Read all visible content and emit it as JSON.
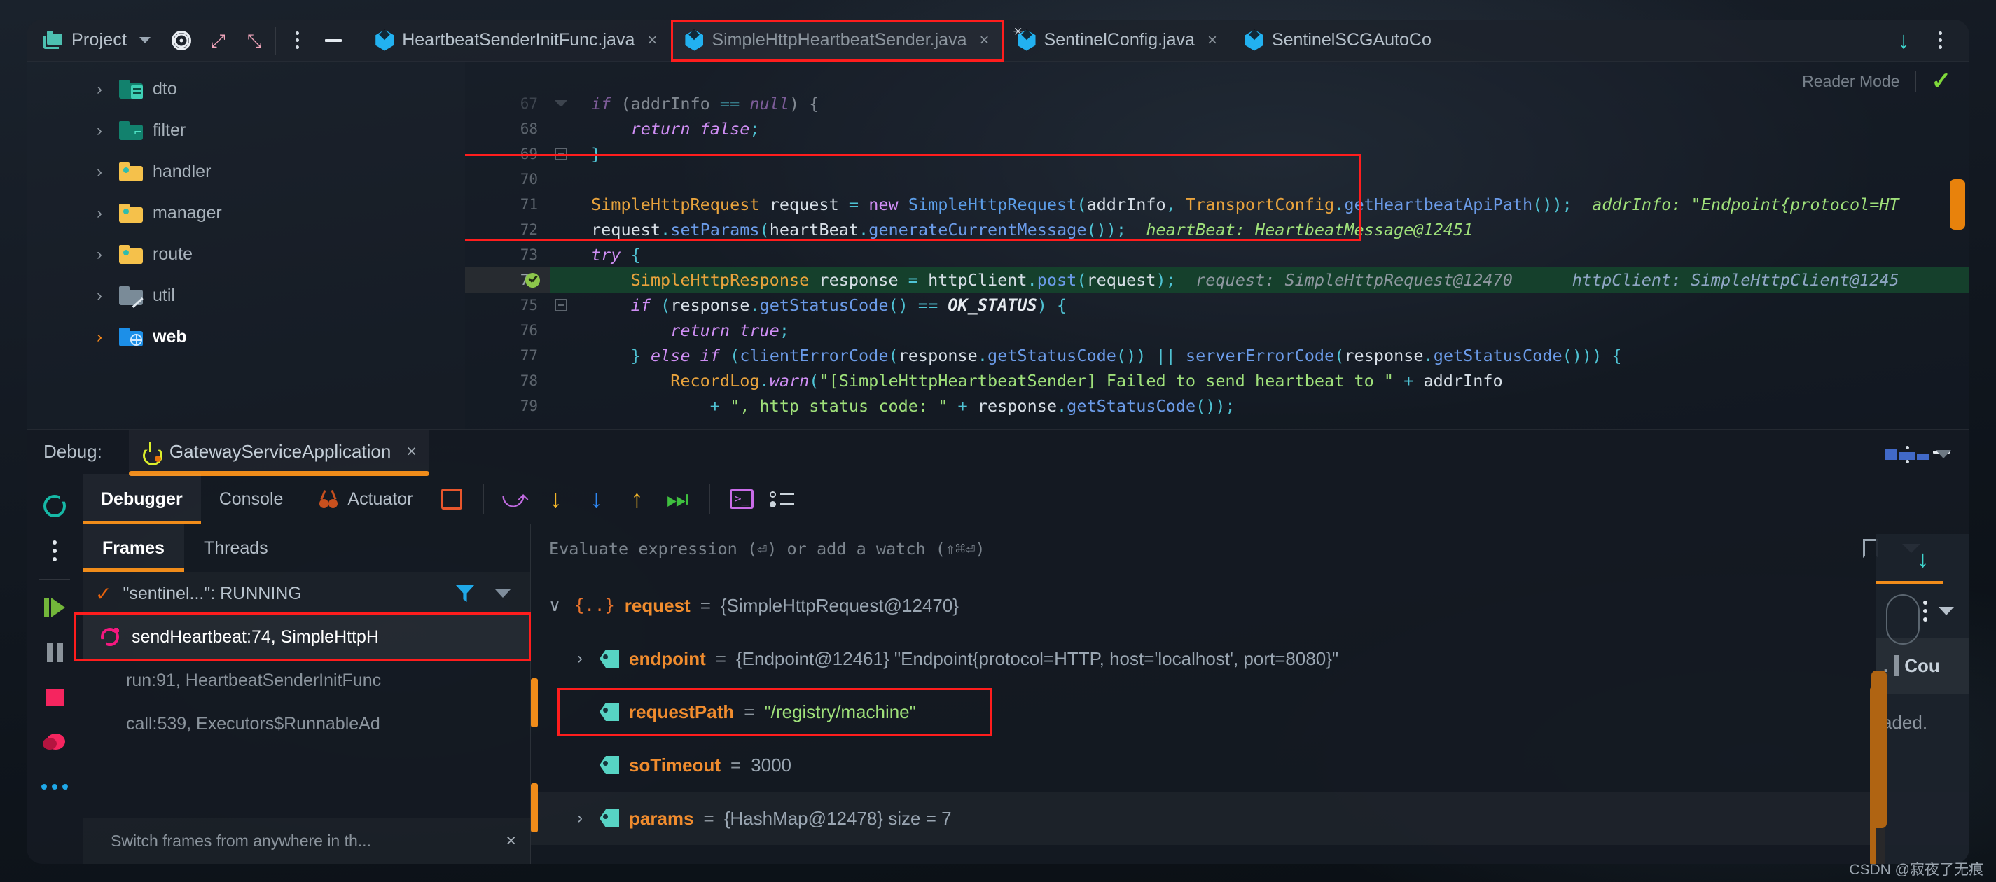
{
  "app": {
    "project_button": "Project",
    "reader_mode": "Reader Mode"
  },
  "editor_tabs": [
    {
      "label": "HeartbeatSenderInitFunc.java",
      "icon": "java-class-icon",
      "active": false,
      "close": "×"
    },
    {
      "label": "SimpleHttpHeartbeatSender.java",
      "icon": "java-class-icon",
      "active": true,
      "close": "×"
    },
    {
      "label": "SentinelConfig.java",
      "icon": "java-class-snowflake-icon",
      "active": false,
      "close": "×"
    },
    {
      "label": "SentinelSCGAutoCo",
      "icon": "java-class-icon",
      "active": false,
      "close": ""
    }
  ],
  "project_tree": [
    {
      "label": "dto",
      "icon": "folder-green-dto",
      "arrow": "›",
      "expanded": false
    },
    {
      "label": "filter",
      "icon": "folder-green-filter",
      "arrow": "›",
      "expanded": false
    },
    {
      "label": "handler",
      "icon": "folder-yellow",
      "arrow": "›",
      "expanded": false
    },
    {
      "label": "manager",
      "icon": "folder-yellow",
      "arrow": "›",
      "expanded": false
    },
    {
      "label": "route",
      "icon": "folder-yellow",
      "arrow": "›",
      "expanded": false
    },
    {
      "label": "util",
      "icon": "folder-grey-excluded",
      "arrow": "›",
      "expanded": false
    },
    {
      "label": "web",
      "icon": "folder-blue-web",
      "arrow": "›",
      "expanded": true
    }
  ],
  "code": {
    "lines": [
      {
        "num": "67",
        "fold": "tri"
      },
      {
        "num": "68",
        "fold": ""
      },
      {
        "num": "69",
        "fold": "box"
      },
      {
        "num": "70",
        "fold": ""
      },
      {
        "num": "71",
        "fold": ""
      },
      {
        "num": "72",
        "fold": ""
      },
      {
        "num": "73",
        "fold": ""
      },
      {
        "num": "74",
        "fold": "",
        "executing": true
      },
      {
        "num": "75",
        "fold": "box"
      },
      {
        "num": "76",
        "fold": ""
      },
      {
        "num": "77",
        "fold": ""
      },
      {
        "num": "78",
        "fold": ""
      },
      {
        "num": "79",
        "fold": ""
      }
    ],
    "inlay_hints": {
      "addr_info": "addrInfo: \"Endpoint{protocol=HT",
      "heart_beat": "heartBeat: HeartbeatMessage@12451",
      "request": "request: SimpleHttpRequest@12470",
      "http_client": "httpClient: SimpleHttpClient@1245"
    }
  },
  "debug": {
    "label": "Debug:",
    "run_config": "GatewayServiceApplication",
    "close": "×",
    "tabs": [
      {
        "label": "Debugger",
        "active": true
      },
      {
        "label": "Console",
        "active": false
      },
      {
        "label": "Actuator",
        "active": false,
        "icon": "actuator-icon"
      }
    ],
    "frame_tabs": [
      {
        "label": "Frames",
        "active": true
      },
      {
        "label": "Threads",
        "active": false
      }
    ],
    "thread": "\"sentinel...\": RUNNING",
    "frames": [
      {
        "label": "sendHeartbeat:74, SimpleHttpH",
        "selected": true,
        "icon": "recursion-icon"
      },
      {
        "label": "run:91, HeartbeatSenderInitFunc",
        "selected": false
      },
      {
        "label": "call:539, Executors$RunnableAd",
        "selected": false
      }
    ],
    "switch_hint": "Switch frames from anywhere in th...",
    "switch_hint_close": "×",
    "evaluate_placeholder": "Evaluate expression (⏎) or add a watch (⇧⌘⏎)",
    "variables": [
      {
        "indent": 0,
        "twisty": "∨",
        "icon": "object-braces-icon",
        "name": "request",
        "eq": " = ",
        "value": "{SimpleHttpRequest@12470}",
        "value_kind": "plain"
      },
      {
        "indent": 1,
        "twisty": "›",
        "icon": "field-tag-icon",
        "name": "endpoint",
        "eq": " = ",
        "value": "{Endpoint@12461} \"Endpoint{protocol=HTTP, host='localhost', port=8080}\"",
        "value_kind": "plain"
      },
      {
        "indent": 1,
        "twisty": "",
        "icon": "field-tag-icon",
        "name": "requestPath",
        "eq": " = ",
        "value": "\"/registry/machine\"",
        "value_kind": "string",
        "highlighted": true
      },
      {
        "indent": 1,
        "twisty": "",
        "icon": "field-tag-icon",
        "name": "soTimeout",
        "eq": " = ",
        "value": "3000",
        "value_kind": "plain"
      },
      {
        "indent": 1,
        "twisty": "›",
        "icon": "field-tag-icon",
        "name": "params",
        "eq": " = ",
        "value": "{HashMap@12478}  size = 7",
        "value_kind": "plain"
      }
    ]
  },
  "right_panel": {
    "cou_text": "Cou",
    "loaded_text": "aded."
  },
  "watermark": "CSDN @寂夜了无痕",
  "colors": {
    "accent_orange": "#F08C1A",
    "highlight_red": "#ff1d1d",
    "exec_line_green": "#15402C",
    "string_green": "#9FE07A",
    "var_name_orange": "#F08C2E",
    "java_icon_blue": "#22B1F0"
  }
}
